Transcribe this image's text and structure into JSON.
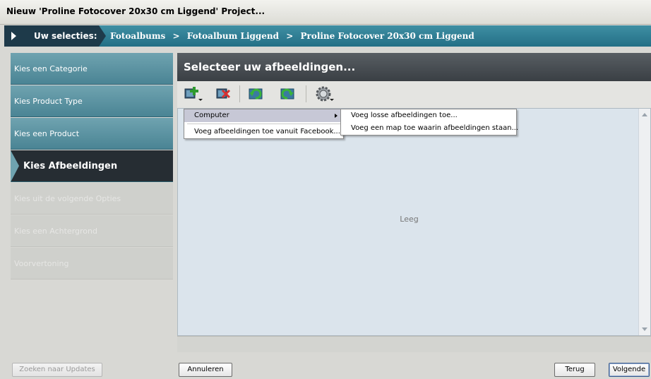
{
  "window": {
    "title": "Nieuw 'Proline Fotocover 20x30 cm Liggend' Project..."
  },
  "breadcrumb": {
    "label": "Uw selecties:",
    "items": [
      "Fotoalbums",
      "Fotoalbum Liggend",
      "Proline Fotocover 20x30 cm Liggend"
    ],
    "separator": ">"
  },
  "sidebar": {
    "items": [
      {
        "label": "Kies een Categorie",
        "state": "done"
      },
      {
        "label": "Kies Product Type",
        "state": "done"
      },
      {
        "label": "Kies een Product",
        "state": "done"
      },
      {
        "label": "Kies Afbeeldingen",
        "state": "active"
      },
      {
        "label": "Kies uit de volgende Opties",
        "state": "disabled"
      },
      {
        "label": "Kies een Achtergrond",
        "state": "disabled"
      },
      {
        "label": "Voorvertoning",
        "state": "disabled"
      }
    ]
  },
  "panel": {
    "title": "Selecteer uw afbeeldingen...",
    "empty_text": "Leeg"
  },
  "toolbar": {
    "icons": [
      "add-image-icon",
      "remove-image-icon",
      "rotate-left-icon",
      "rotate-right-icon",
      "settings-gear-icon"
    ]
  },
  "menu": {
    "items": [
      "Computer",
      "Voeg afbeeldingen toe vanuit Facebook..."
    ],
    "submenu": [
      "Voeg losse afbeeldingen toe...",
      "Voeg een map toe waarin afbeeldingen staan..."
    ]
  },
  "buttons": {
    "updates": "Zoeken naar Updates",
    "cancel": "Annuleren",
    "back": "Terug",
    "next": "Volgende"
  },
  "colors": {
    "accent_teal": "#3f8fa3",
    "dark_panel": "#3a3f44",
    "canvas_bg": "#dbe4ec"
  }
}
